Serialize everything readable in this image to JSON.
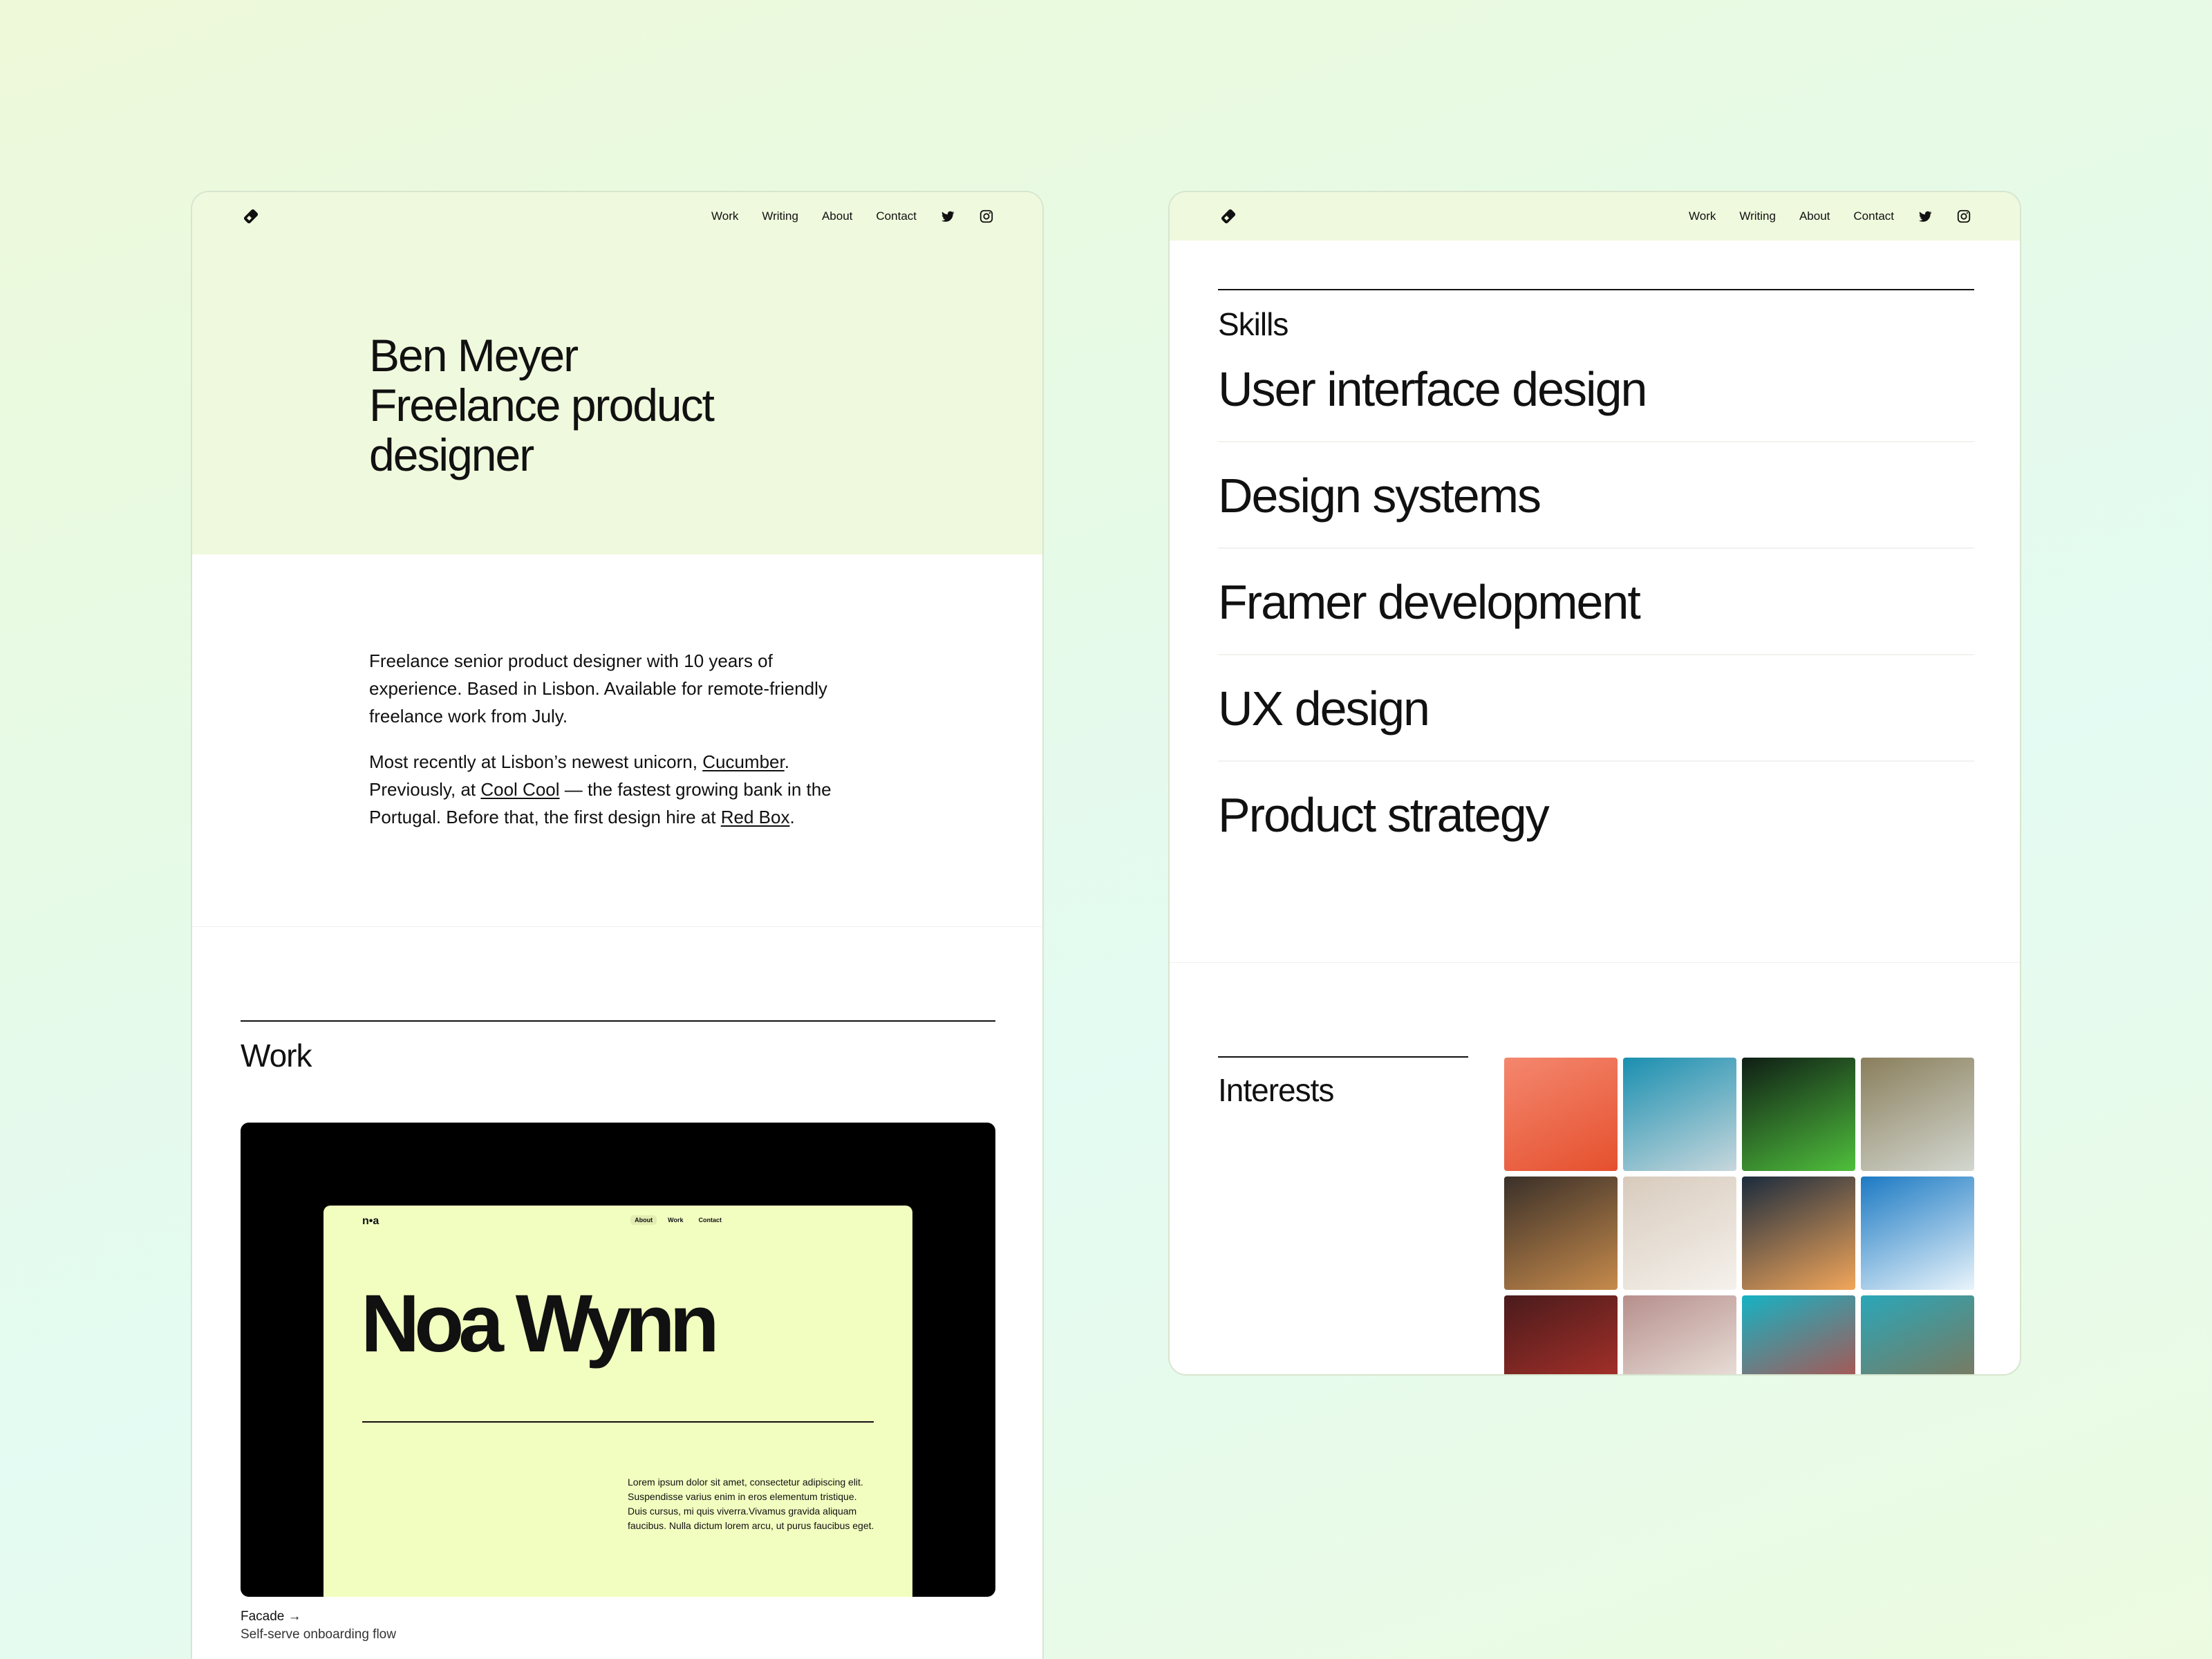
{
  "nav": {
    "links": [
      "Work",
      "Writing",
      "About",
      "Contact"
    ],
    "icons": [
      "twitter-icon",
      "instagram-icon"
    ]
  },
  "hero": {
    "title_line1": "Ben Meyer",
    "title_line2": "Freelance product",
    "title_line3": "designer"
  },
  "intro": {
    "p1": "Freelance senior product designer with 10 years of experience. Based in Lisbon. Available for remote-friendly freelance work from July.",
    "p2_a": "Most recently at Lisbon’s newest unicorn, ",
    "link1": "Cucumber",
    "p2_b": ". Previously, at ",
    "link2": "Cool Cool",
    "p2_c": " — the fastest growing bank in the Portugal. Before that, the first design hire at ",
    "link3": "Red Box",
    "p2_d": "."
  },
  "work": {
    "section_title": "Work",
    "card": {
      "mock_logo": "n•a",
      "mock_nav": [
        "About",
        "Work",
        "Contact"
      ],
      "mock_title": "Noa Wynn",
      "mock_text": "Lorem ipsum dolor sit amet, consectetur adipiscing elit. Suspendisse varius enim in eros elementum tristique. Duis cursus, mi quis viverra.Vivamus gravida aliquam faucibus. Nulla dictum lorem arcu, ut purus faucibus eget."
    },
    "caption_title": "Facade →",
    "caption_sub": "Self-serve onboarding flow"
  },
  "skills": {
    "label": "Skills",
    "items": [
      "User interface design",
      "Design systems",
      "Framer development",
      "UX design",
      "Product strategy"
    ]
  },
  "interests": {
    "label": "Interests",
    "tiles": [
      {
        "name": "coral-plant-photo",
        "colors": [
          "#f4876e",
          "#e5502e"
        ]
      },
      {
        "name": "architecture-wave-photo",
        "colors": [
          "#1a8fb0",
          "#c7d7dc"
        ]
      },
      {
        "name": "aurora-photo",
        "colors": [
          "#0f1e15",
          "#4fbf3c"
        ]
      },
      {
        "name": "coast-rock-photo",
        "colors": [
          "#8a7f5c",
          "#d3d7d0"
        ]
      },
      {
        "name": "interior-chairs-photo",
        "colors": [
          "#3a3029",
          "#c68a4b"
        ]
      },
      {
        "name": "sand-hand-photo",
        "colors": [
          "#d8cbbd",
          "#f5f1ec"
        ]
      },
      {
        "name": "sunset-sea-photo",
        "colors": [
          "#1b2b3d",
          "#f2a65a"
        ]
      },
      {
        "name": "skier-jump-photo",
        "colors": [
          "#1c7ac3",
          "#e9f4fb"
        ]
      },
      {
        "name": "runner-track-photo",
        "colors": [
          "#4a1b1c",
          "#b8342c"
        ]
      },
      {
        "name": "tennis-ball-photo",
        "colors": [
          "#b78f8c",
          "#f3f0e9"
        ]
      },
      {
        "name": "hot-air-balloons-photo",
        "colors": [
          "#16b2c3",
          "#c9433c"
        ]
      },
      {
        "name": "mountain-lake-photo",
        "colors": [
          "#2aa7b8",
          "#8b6f4c"
        ]
      }
    ]
  }
}
